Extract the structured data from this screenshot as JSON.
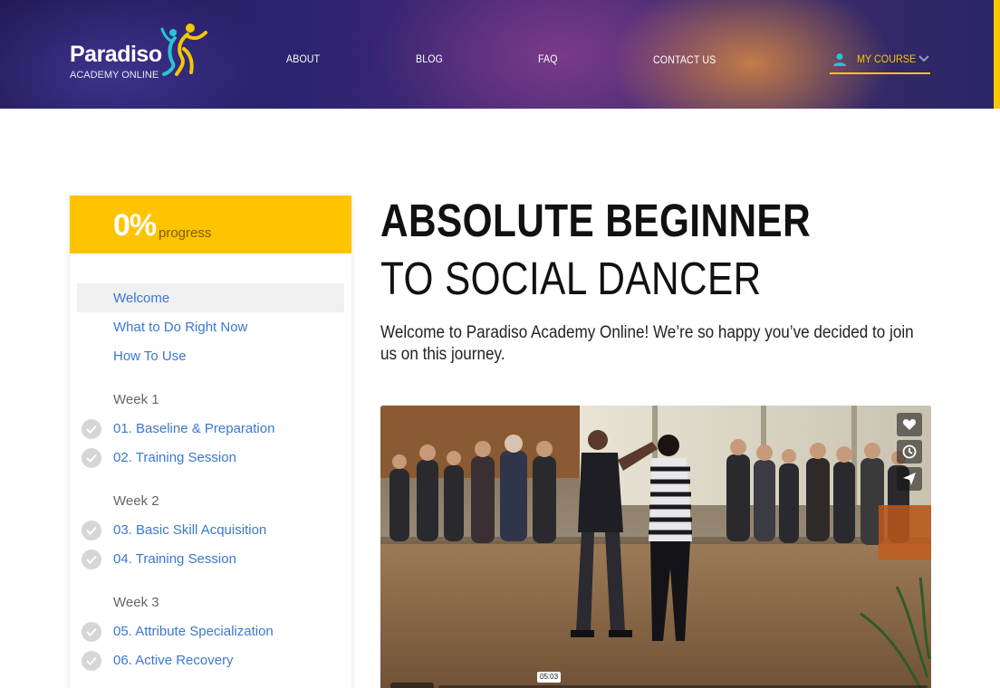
{
  "header": {
    "logo": {
      "wordmark": "Paradiso",
      "tagline": "ACADEMY ONLINE"
    },
    "nav": [
      {
        "label": "ABOUT"
      },
      {
        "label": "BLOG"
      },
      {
        "label": "FAQ"
      },
      {
        "label": "CONTACT US"
      }
    ],
    "account": {
      "label": "MY COURSE",
      "icon": "user-icon",
      "chevron": "chevron-down-icon"
    },
    "accent_color": "#f6c700"
  },
  "sidebar": {
    "progress": {
      "value": "0%",
      "label": "progress"
    },
    "lessons_intro": [
      {
        "label": "Welcome",
        "active": true
      },
      {
        "label": "What to Do Right Now"
      },
      {
        "label": "How To Use"
      }
    ],
    "weeks": [
      {
        "title": "Week 1",
        "lessons": [
          {
            "label": "01. Baseline & Preparation",
            "icon": "check-icon"
          },
          {
            "label": "02. Training Session",
            "icon": "check-icon"
          }
        ]
      },
      {
        "title": "Week 2",
        "lessons": [
          {
            "label": "03. Basic Skill Acquisition",
            "icon": "check-icon"
          },
          {
            "label": "04. Training Session",
            "icon": "check-icon"
          }
        ]
      },
      {
        "title": "Week 3",
        "lessons": [
          {
            "label": "05. Attribute Specialization",
            "icon": "check-icon"
          },
          {
            "label": "06. Active Recovery",
            "icon": "check-icon"
          }
        ]
      }
    ],
    "progress_color": "#ffc300",
    "link_color": "#3a78d0"
  },
  "main": {
    "title_line1": "ABSOLUTE BEGINNER",
    "title_line2": "TO SOCIAL DANCER",
    "intro": "Welcome to Paradiso Academy Online! We’re so happy you’ve decided to join us on this journey.",
    "video": {
      "time_tooltip": "05:03",
      "controls": [
        "heart-icon",
        "clock-icon",
        "share-icon"
      ]
    }
  }
}
